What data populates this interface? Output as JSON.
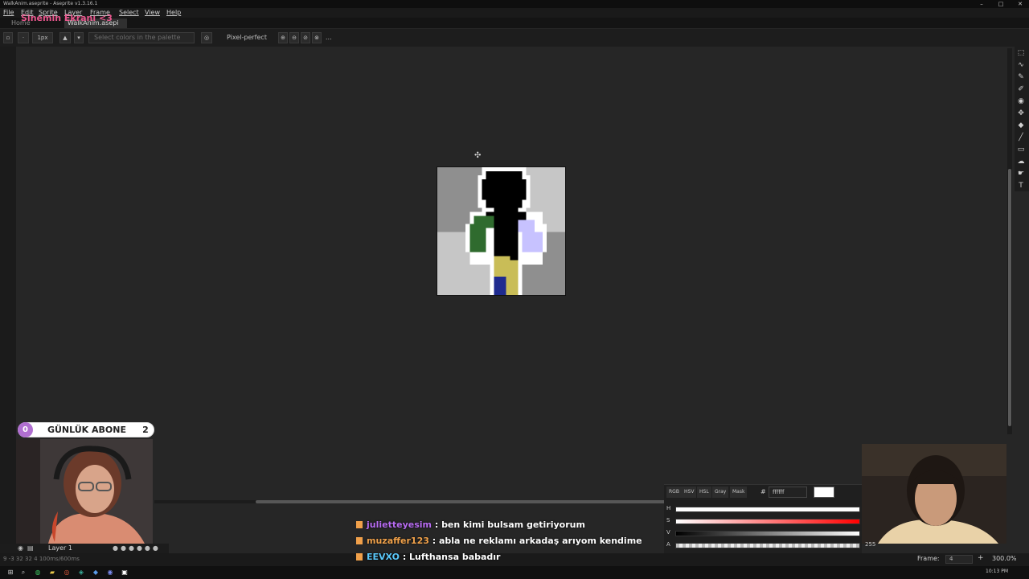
{
  "window": {
    "title": "WalkAnim.aseprite - Aseprite v1.3.16.1",
    "minimize": "–",
    "maximize": "□",
    "close": "✕"
  },
  "menu": [
    "File",
    "Edit",
    "Sprite",
    "Layer",
    "Frame",
    "Select",
    "View",
    "Help"
  ],
  "stream_label": "Sinemin Ekranı <3",
  "tabs": [
    {
      "label": "Home"
    },
    {
      "label": "WalkAnim.asepi"
    }
  ],
  "tab_close": "×",
  "toolbar": {
    "brush_size": "1px",
    "palette_placeholder": "Select colors in the palette",
    "pixel_perfect": "Pixel-perfect",
    "more": "..."
  },
  "overlay": {
    "abone_badge": "0",
    "abone_title": "GÜNLÜK ABONE",
    "abone_count": "2"
  },
  "color_panel": {
    "modes": [
      "RGB",
      "HSV",
      "HSL",
      "Gray",
      "Mask"
    ],
    "hex_label": "#",
    "hex_value": "ffffff",
    "current_color": "#ffffff",
    "sliders": [
      {
        "label": "H"
      },
      {
        "label": "S"
      },
      {
        "label": "V"
      },
      {
        "label": "A",
        "value": "255"
      }
    ]
  },
  "timeline": {
    "layer_name": "Layer 1",
    "info": "9  -3  32 32  4  100ms/600ms"
  },
  "status": {
    "frame_label": "Frame:",
    "frame_value": "4",
    "zoom": "300.0%"
  },
  "chat": [
    {
      "user": "julietteyesim",
      "user_color": "#b86cf2",
      "message": "ben kimi bulsam getiriyorum"
    },
    {
      "user": "muzaffer123",
      "user_color": "#f0a14a",
      "message": "abla ne reklamı arkadaş arıyom kendime"
    },
    {
      "user": "EEVXO",
      "user_color": "#5ac8fa",
      "message": "Lufthansa babadır"
    }
  ],
  "taskbar": {
    "clock": "10:13 PM"
  },
  "icons": {
    "menu": "menu-icon",
    "search": "search-icon",
    "settings": "gear-icon",
    "marquee": "marquee-tool-icon",
    "pencil": "pencil-tool-icon",
    "eraser": "eraser-tool-icon",
    "eyedropper": "eyedropper-tool-icon",
    "move": "move-tool-icon",
    "fill": "fill-tool-icon",
    "line": "line-tool-icon",
    "rect": "rectangle-tool-icon",
    "text": "text-tool-icon"
  },
  "sprite_colors": {
    "bg_dark": "#8f8f8f",
    "bg_light": "#c6c6c6",
    "body": "#000000",
    "arm_left": "#2f6b2e",
    "arm_right": "#c7c2ff",
    "leg_yellow": "#c9bd57",
    "leg_blue": "#1f2b8f",
    "outline": "#ffffff"
  }
}
